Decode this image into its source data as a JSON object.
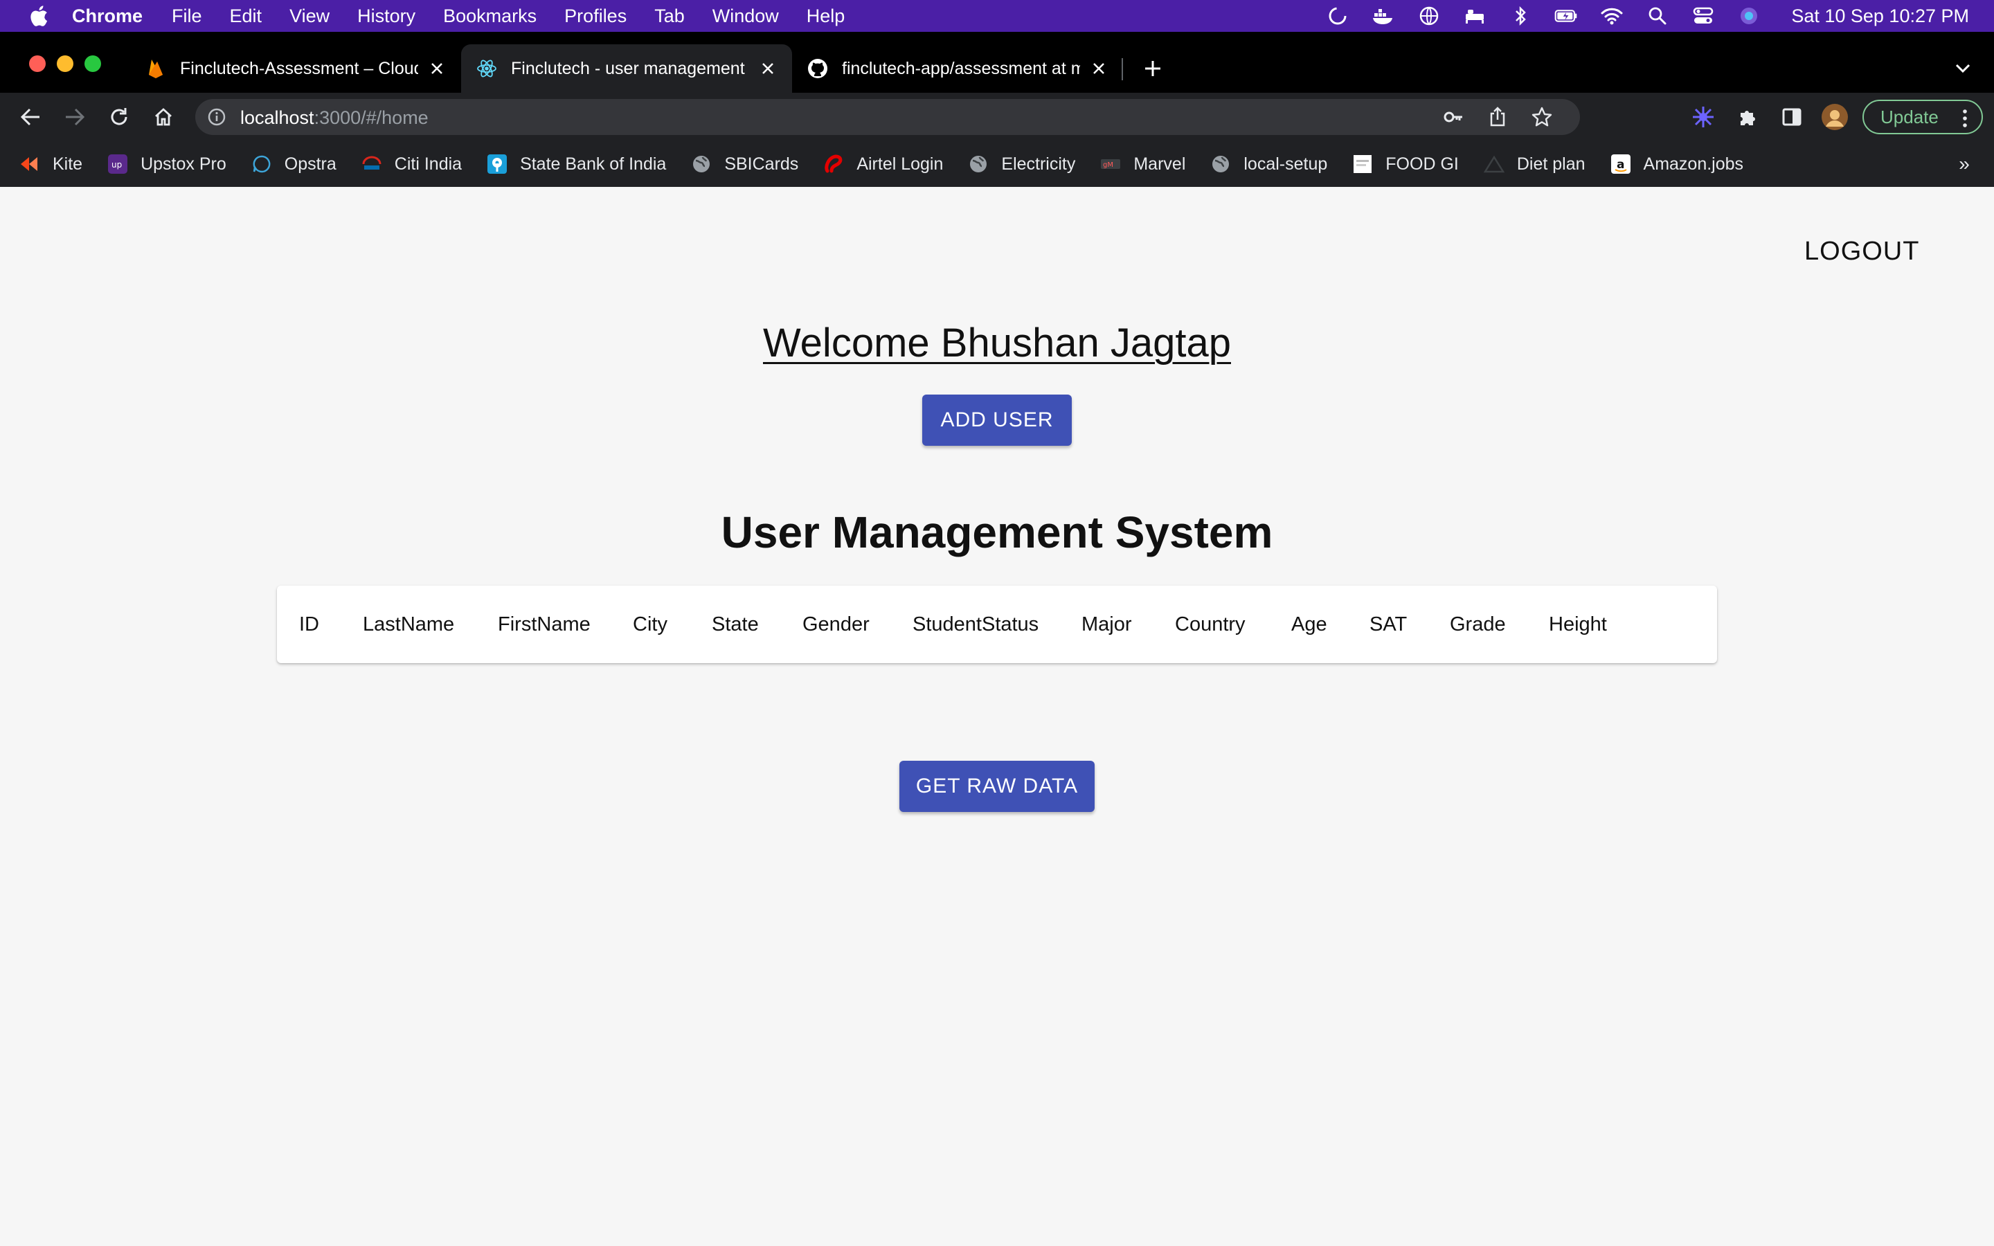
{
  "menubar": {
    "app_name": "Chrome",
    "items": [
      "File",
      "Edit",
      "View",
      "History",
      "Bookmarks",
      "Profiles",
      "Tab",
      "Window",
      "Help"
    ],
    "clock": "Sat 10 Sep  10:27 PM"
  },
  "tabs": [
    {
      "title": "Finclutech-Assessment – Cloud",
      "favicon": "firebase-icon",
      "active": false
    },
    {
      "title": "Finclutech - user management",
      "favicon": "react-icon",
      "active": true
    },
    {
      "title": "finclutech-app/assessment at m",
      "favicon": "github-icon",
      "active": false
    }
  ],
  "toolbar": {
    "url_host": "localhost",
    "url_rest": ":3000/#/home",
    "update_label": "Update"
  },
  "bookmarks": [
    {
      "label": "Kite",
      "icon": "kite-icon"
    },
    {
      "label": "Upstox Pro",
      "icon": "upstox-icon"
    },
    {
      "label": "Opstra",
      "icon": "opstra-icon"
    },
    {
      "label": "Citi India",
      "icon": "citi-icon"
    },
    {
      "label": "State Bank of India",
      "icon": "sbi-icon"
    },
    {
      "label": "SBICards",
      "icon": "globe-icon"
    },
    {
      "label": "Airtel Login",
      "icon": "airtel-icon"
    },
    {
      "label": "Electricity",
      "icon": "globe-icon"
    },
    {
      "label": "Marvel",
      "icon": "marvel-icon"
    },
    {
      "label": "local-setup",
      "icon": "globe-icon"
    },
    {
      "label": "FOOD GI",
      "icon": "food-icon"
    },
    {
      "label": "Diet plan",
      "icon": "diet-icon"
    },
    {
      "label": "Amazon.jobs",
      "icon": "amazon-icon"
    }
  ],
  "page": {
    "logout_label": "LOGOUT",
    "welcome": "Welcome Bhushan Jagtap",
    "add_user_label": "ADD USER",
    "title": "User Management System",
    "table_columns": [
      "ID",
      "LastName",
      "FirstName",
      "City",
      "State",
      "Gender",
      "StudentStatus",
      "Major",
      "Country",
      "Age",
      "SAT",
      "Grade",
      "Height"
    ],
    "raw_data_label": "GET RAW DATA"
  },
  "colors": {
    "menubar_bg": "#4b1fa6",
    "primary_button": "#3f51b5",
    "update_accent": "#81c995"
  }
}
